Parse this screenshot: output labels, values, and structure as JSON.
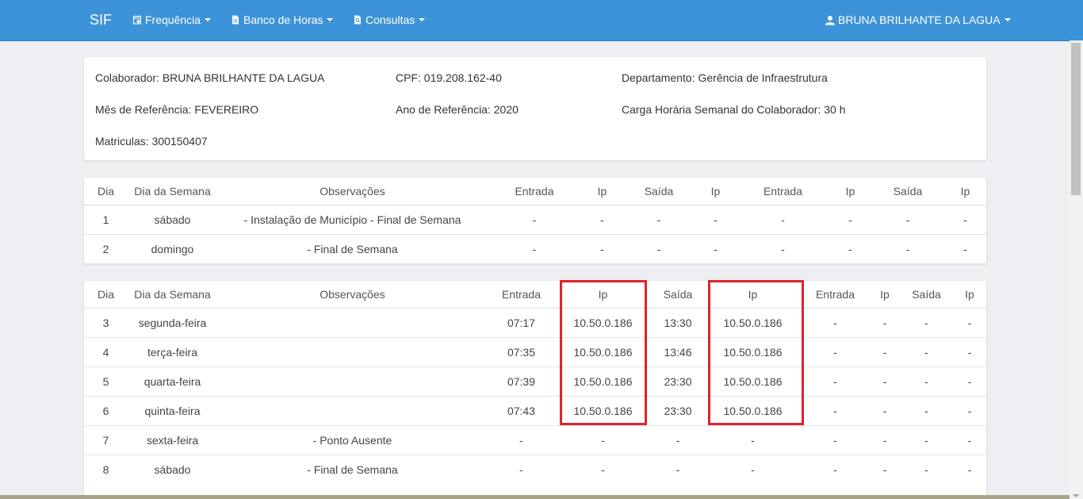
{
  "nav": {
    "brand": "SIF",
    "menu": [
      "Frequência",
      "Banco de Horas",
      "Consultas"
    ],
    "user": "BRUNA BRILHANTE DA LAGUA"
  },
  "info": {
    "colaborador": "Colaborador: BRUNA BRILHANTE DA LAGUA",
    "cpf": "CPF: 019.208.162-40",
    "departamento": "Departamento: Gerência de Infraestrutura",
    "mes": "Mês de Referência: FEVEREIRO",
    "ano": "Ano de Referência: 2020",
    "carga": "Carga Horária Semanal do Colaborador: 30 h",
    "matriculas": "Matriculas: 300150407"
  },
  "table_headers": [
    "Dia",
    "Dia da Semana",
    "Observações",
    "Entrada",
    "Ip",
    "Saída",
    "Ip",
    "Entrada",
    "Ip",
    "Saída",
    "Ip"
  ],
  "week1": [
    [
      "1",
      "sábado",
      "- Instalação de Município - Final de Semana",
      "-",
      "-",
      "-",
      "-",
      "-",
      "-",
      "-",
      "-"
    ],
    [
      "2",
      "domingo",
      "- Final de Semana",
      "-",
      "-",
      "-",
      "-",
      "-",
      "-",
      "-",
      "-"
    ]
  ],
  "week2": [
    [
      "3",
      "segunda-feira",
      "",
      "07:17",
      "10.50.0.186",
      "13:30",
      "10.50.0.186",
      "-",
      "-",
      "-",
      "-"
    ],
    [
      "4",
      "terça-feira",
      "",
      "07:35",
      "10.50.0.186",
      "13:46",
      "10.50.0.186",
      "-",
      "-",
      "-",
      "-"
    ],
    [
      "5",
      "quarta-feira",
      "",
      "07:39",
      "10.50.0.186",
      "23:30",
      "10.50.0.186",
      "-",
      "-",
      "-",
      "-"
    ],
    [
      "6",
      "quinta-feira",
      "",
      "07:43",
      "10.50.0.186",
      "23:30",
      "10.50.0.186",
      "-",
      "-",
      "-",
      "-"
    ],
    [
      "7",
      "sexta-feira",
      "- Ponto Ausente",
      "-",
      "-",
      "-",
      "-",
      "-",
      "-",
      "-",
      "-"
    ],
    [
      "8",
      "sábado",
      "- Final de Semana",
      "-",
      "-",
      "-",
      "-",
      "-",
      "-",
      "-",
      "-"
    ]
  ],
  "colors": {
    "navbar": "#3d93d8",
    "highlight": "#e0222b",
    "background": "#eeeff2"
  }
}
